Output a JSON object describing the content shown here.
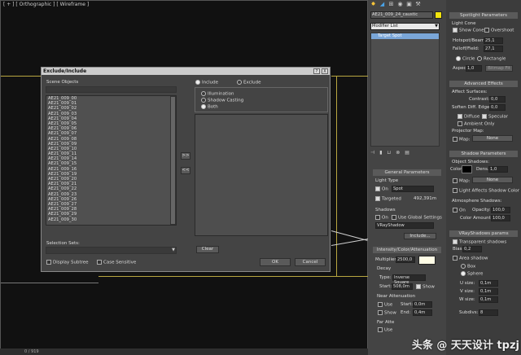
{
  "viewport": {
    "label": "[ + ] [ Orthographic ] [ Wireframe ]",
    "status": "0 / 919"
  },
  "dialog": {
    "title": "Exclude/Include",
    "title_buttons": [
      "?",
      "X"
    ],
    "scene_objects_label": "Scene Objects",
    "objects": [
      "AE21_009_00",
      "AE21_009_01",
      "AE21_009_02",
      "AE21_009_03",
      "AE21_009_04",
      "AE21_009_05",
      "AE21_009_06",
      "AE21_009_07",
      "AE21_009_08",
      "AE21_009_09",
      "AE21_009_10",
      "AE21_009_11",
      "AE21_009_14",
      "AE21_009_15",
      "AE21_009_16",
      "AE21_009_19",
      "AE21_009_20",
      "AE21_009_21",
      "AE21_009_22",
      "AE21_009_23",
      "AE21_009_26",
      "AE21_009_27",
      "AE21_009_28",
      "AE21_009_29",
      "AE21_009_30"
    ],
    "include_label": "Include",
    "exclude_label": "Exclude",
    "illumination_label": "Illumination",
    "shadow_casting_label": "Shadow Casting",
    "both_label": "Both",
    "move_right": ">>",
    "move_left": "<<",
    "clear_label": "Clear",
    "selection_sets_label": "Selection Sets:",
    "display_subtree_label": "Display Subtree",
    "case_sensitive_label": "Case Sensitive",
    "ok_label": "OK",
    "cancel_label": "Cancel"
  },
  "cmd": {
    "object_name": "AE21_009_24_caustic",
    "modifier_list": "Modifier List",
    "stack_item": "Target Spot",
    "general": {
      "title": "General Parameters",
      "light_type": "Light Type",
      "on": "On",
      "type_value": "Spot",
      "targeted": "Targeted",
      "target_dist": "492,391m",
      "shadows": "Shadows",
      "shadows_on": "On",
      "use_global": "Use Global Settings",
      "shadow_type": "VRayShadow",
      "include_btn": "Include..."
    },
    "intensity": {
      "title": "Intensity/Color/Attenuation",
      "multiplier_label": "Multiplier:",
      "multiplier": "2500,0",
      "decay": "Decay",
      "type_label": "Type:",
      "type_value": "Inverse Square",
      "start_label": "Start:",
      "start_value": "508,0m",
      "show": "Show",
      "near_att": "Near Attenuation",
      "use": "Use",
      "near_start_label": "Start:",
      "near_start": "0,0m",
      "near_show": "Show",
      "end_label": "End:",
      "end_value": "0,4m",
      "far_att": "Far Atte",
      "far_use": "Use"
    }
  },
  "rollouts": {
    "spot": {
      "title": "Spotlight Parameters",
      "light_cone": "Light Cone",
      "show_cone": "Show Cone",
      "overshoot": "Overshoot",
      "hotspot_label": "Hotspot/Beam:",
      "hotspot": "25,1",
      "falloff_label": "Falloff/Field:",
      "falloff": "27,1",
      "circle": "Circle",
      "rectangle": "Rectangle",
      "aspect_label": "Aspect:",
      "aspect": "1,0",
      "bitmap_fit": "Bitmap Fit"
    },
    "advanced": {
      "title": "Advanced Effects",
      "affect_surfaces": "Affect Surfaces:",
      "contrast_label": "Contrast:",
      "contrast": "0,0",
      "soften_label": "Soften Diff. Edge:",
      "soften": "0,0",
      "diffuse": "Diffuse",
      "specular": "Specular",
      "ambient_only": "Ambient Only",
      "projector_map": "Projector Map:",
      "map_label": "Map:",
      "map_value": "None"
    },
    "shadow": {
      "title": "Shadow Parameters",
      "object_shadows": "Object Shadows:",
      "color_label": "Color:",
      "dens_label": "Dens.",
      "dens": "1,0",
      "map_label": "Map:",
      "map_value": "None",
      "light_affects": "Light Affects Shadow Color",
      "atmosphere": "Atmosphere Shadows:",
      "atm_on": "On",
      "opacity_label": "Opacity:",
      "opacity": "100,0",
      "color_amount_label": "Color Amount:",
      "color_amount": "100,0"
    },
    "vray": {
      "title": "VRayShadows params",
      "transparent": "Transparent shadows",
      "bias_label": "Bias:",
      "bias": "0,2",
      "area_shadow": "Area shadow",
      "box": "Box",
      "sphere": "Sphere",
      "usize_label": "U size:",
      "usize": "0,1m",
      "vsize_label": "V size:",
      "vsize": "0,1m",
      "wsize_label": "W size:",
      "wsize": "0,1m",
      "subdivs_label": "Subdivs:",
      "subdivs": "8"
    }
  },
  "watermark": "头条 @ 天天设计 tpzj"
}
